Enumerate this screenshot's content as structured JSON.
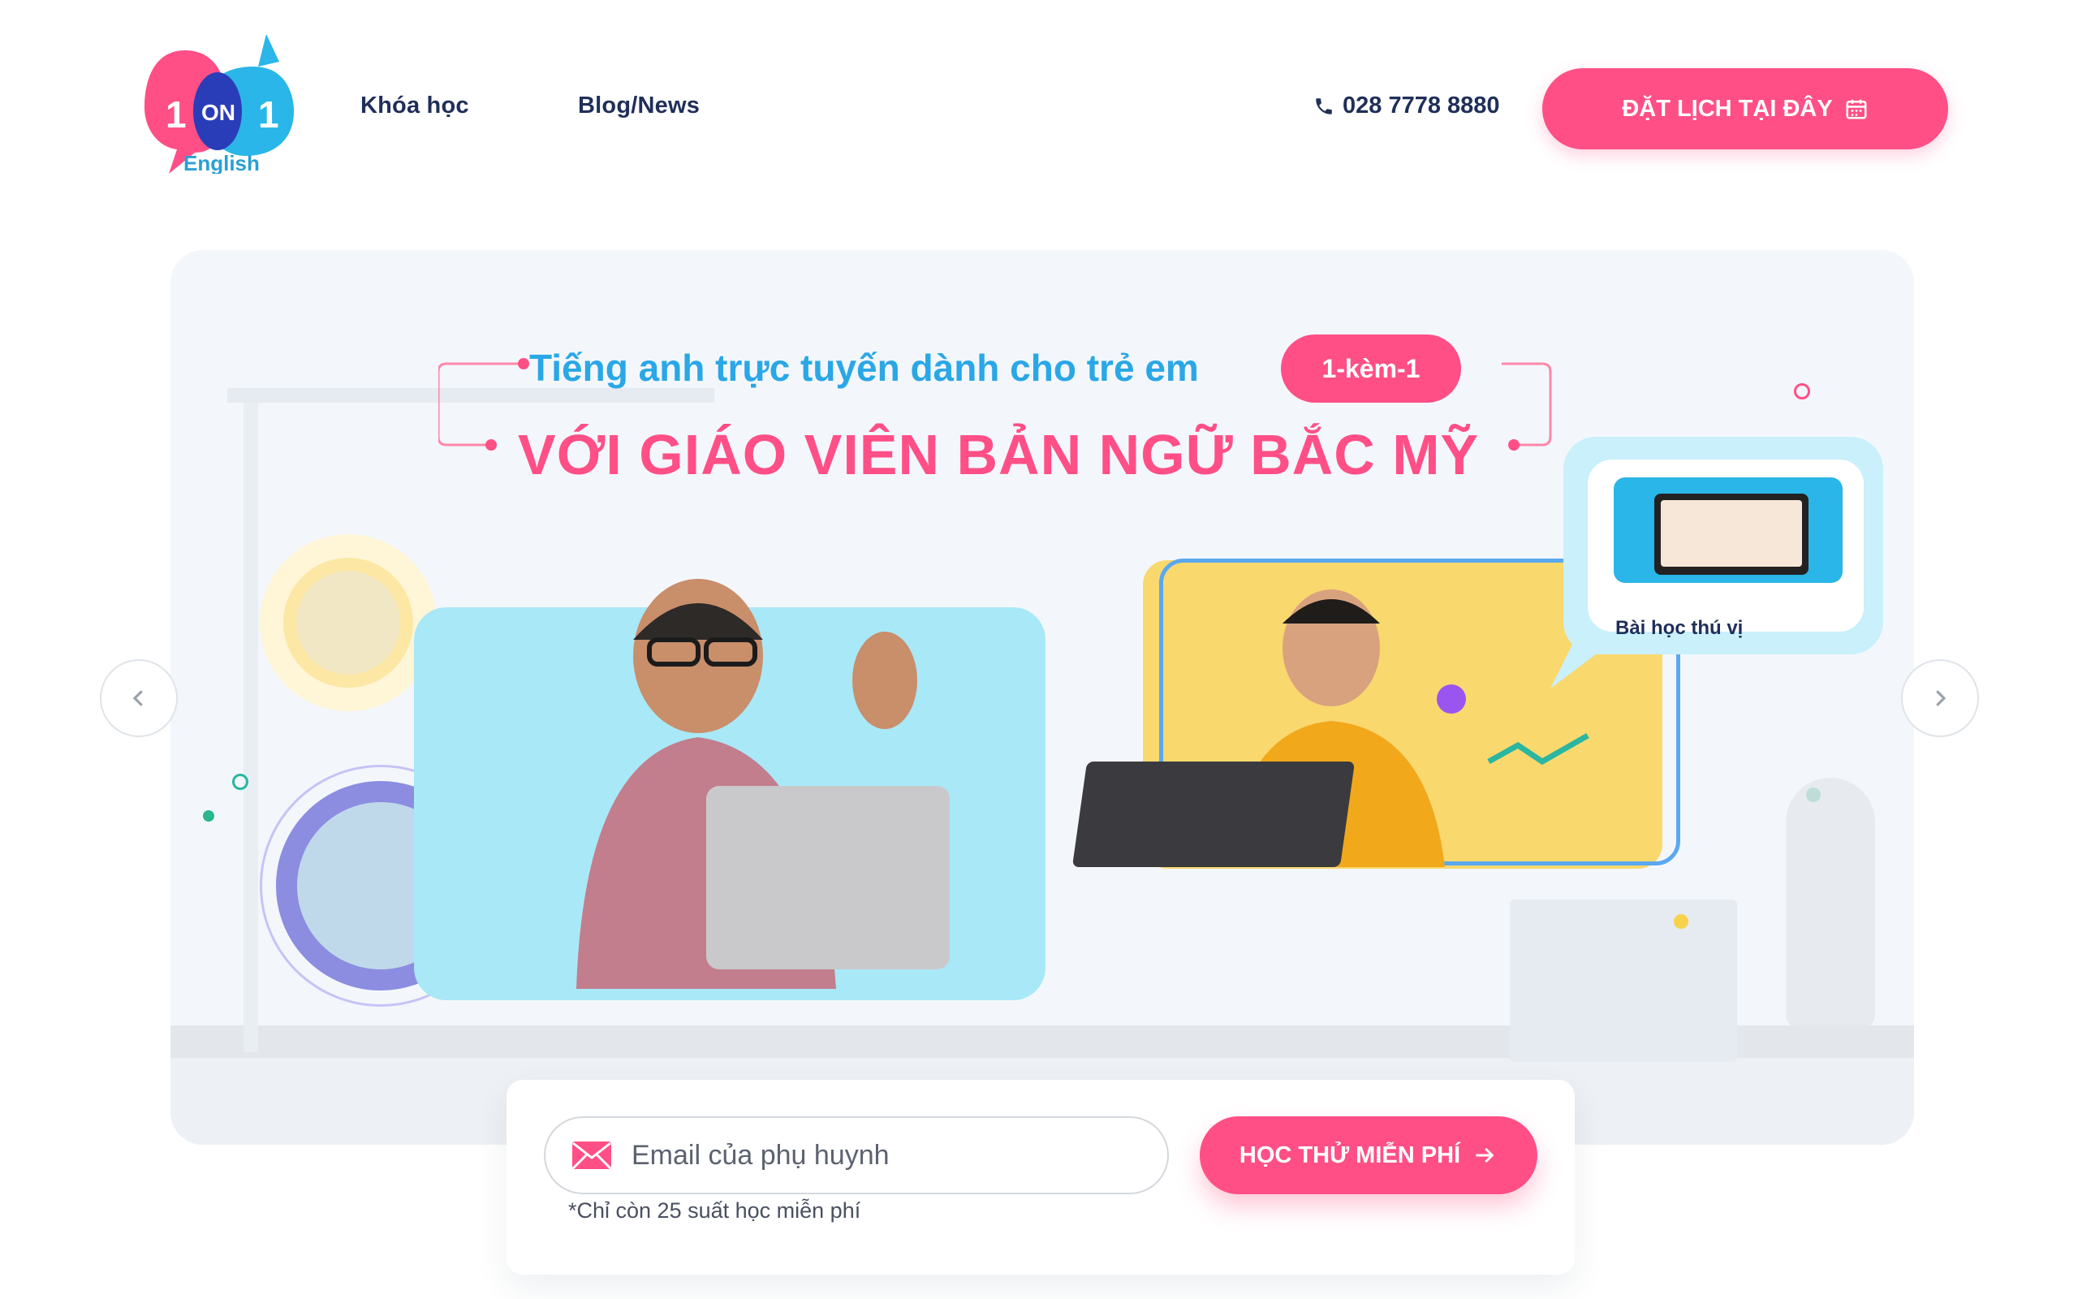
{
  "header": {
    "logo": {
      "top_text_left": "1",
      "top_text_mid": "ON",
      "top_text_right": "1",
      "bottom_text": "English"
    },
    "nav": [
      {
        "label": "Khóa học"
      },
      {
        "label": "Blog/News"
      }
    ],
    "phone": "028 7778 8880",
    "cta_label": "ĐẶT LỊCH TẠI ĐÂY"
  },
  "banner": {
    "headline_sub": "Tiếng anh trực tuyến dành cho trẻ em",
    "pill": "1-kèm-1",
    "headline_main": "VỚI GIÁO VIÊN BẢN NGỮ BẮC MỸ",
    "lesson_label": "Bài học thú vị"
  },
  "signup": {
    "email_placeholder": "Email của phụ huynh",
    "email_value": "",
    "note": "*Chỉ còn 25 suất học miễn phí",
    "cta_label": "HỌC THỬ MIỄN PHÍ"
  },
  "colors": {
    "brand_pink": "#ff4f86",
    "brand_blue": "#2aa7e6",
    "navy": "#1f2f5a"
  },
  "icons": {
    "phone": "phone-icon",
    "calendar": "calendar-icon",
    "email": "email-icon",
    "arrow_right": "arrow-right-icon",
    "prev": "chevron-left-icon",
    "next": "chevron-right-icon"
  }
}
